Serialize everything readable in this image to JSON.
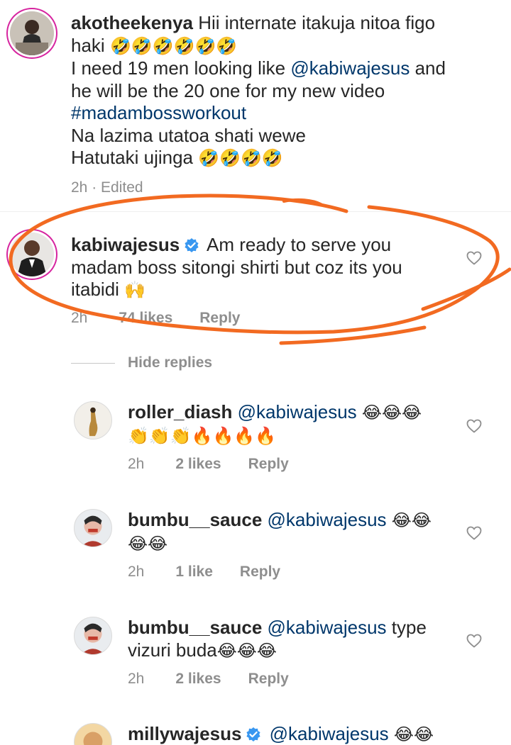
{
  "comments": [
    {
      "username": "akotheekenya",
      "lines": [
        "Hii internate itakuja  nitoa figo",
        "haki",
        "I need 19  men looking like",
        "@kabiwajesus",
        "and",
        "he will be the 20 one for my new  video",
        "#madambossworkout",
        "Na lazima utatoa shati wewe",
        "Hatutaki ujinga"
      ],
      "emoji_rofl": "🤣",
      "time": "2h · Edited"
    },
    {
      "username": "kabiwajesus",
      "verified": true,
      "lines": [
        "Am ready to serve you",
        "madam boss sitongi shirti but coz its you",
        "itabidi"
      ],
      "emoji_hands": "🙌",
      "time": "2h",
      "likes": "74 likes",
      "reply": "Reply"
    }
  ],
  "hide_replies": "Hide replies",
  "replies": [
    {
      "username": "roller_diash",
      "mention": "@kabiwajesus",
      "emoji_line1": "😂😂😂",
      "emoji_line2": "👏👏👏🔥🔥🔥🔥",
      "time": "2h",
      "likes": "2 likes",
      "reply": "Reply"
    },
    {
      "username": "bumbu__sauce",
      "mention": "@kabiwajesus",
      "emoji_line1": "😂😂",
      "emoji_line2": "😂😂",
      "time": "2h",
      "likes": "1 like",
      "reply": "Reply"
    },
    {
      "username": "bumbu__sauce",
      "mention": "@kabiwajesus",
      "text_after": "type",
      "line2": "vizuri buda",
      "emoji_line2": "😂😂😂",
      "time": "2h",
      "likes": "2 likes",
      "reply": "Reply"
    },
    {
      "username": "millywajesus",
      "verified": true,
      "mention": "@kabiwajesus",
      "emoji_line1": "😂😂"
    }
  ],
  "colors": {
    "mention": "#00376b",
    "meta": "#8e8e8e",
    "verified": "#3897f0",
    "scribble": "#f26a21"
  },
  "icons": [
    "heart-icon",
    "verified-badge-icon"
  ]
}
